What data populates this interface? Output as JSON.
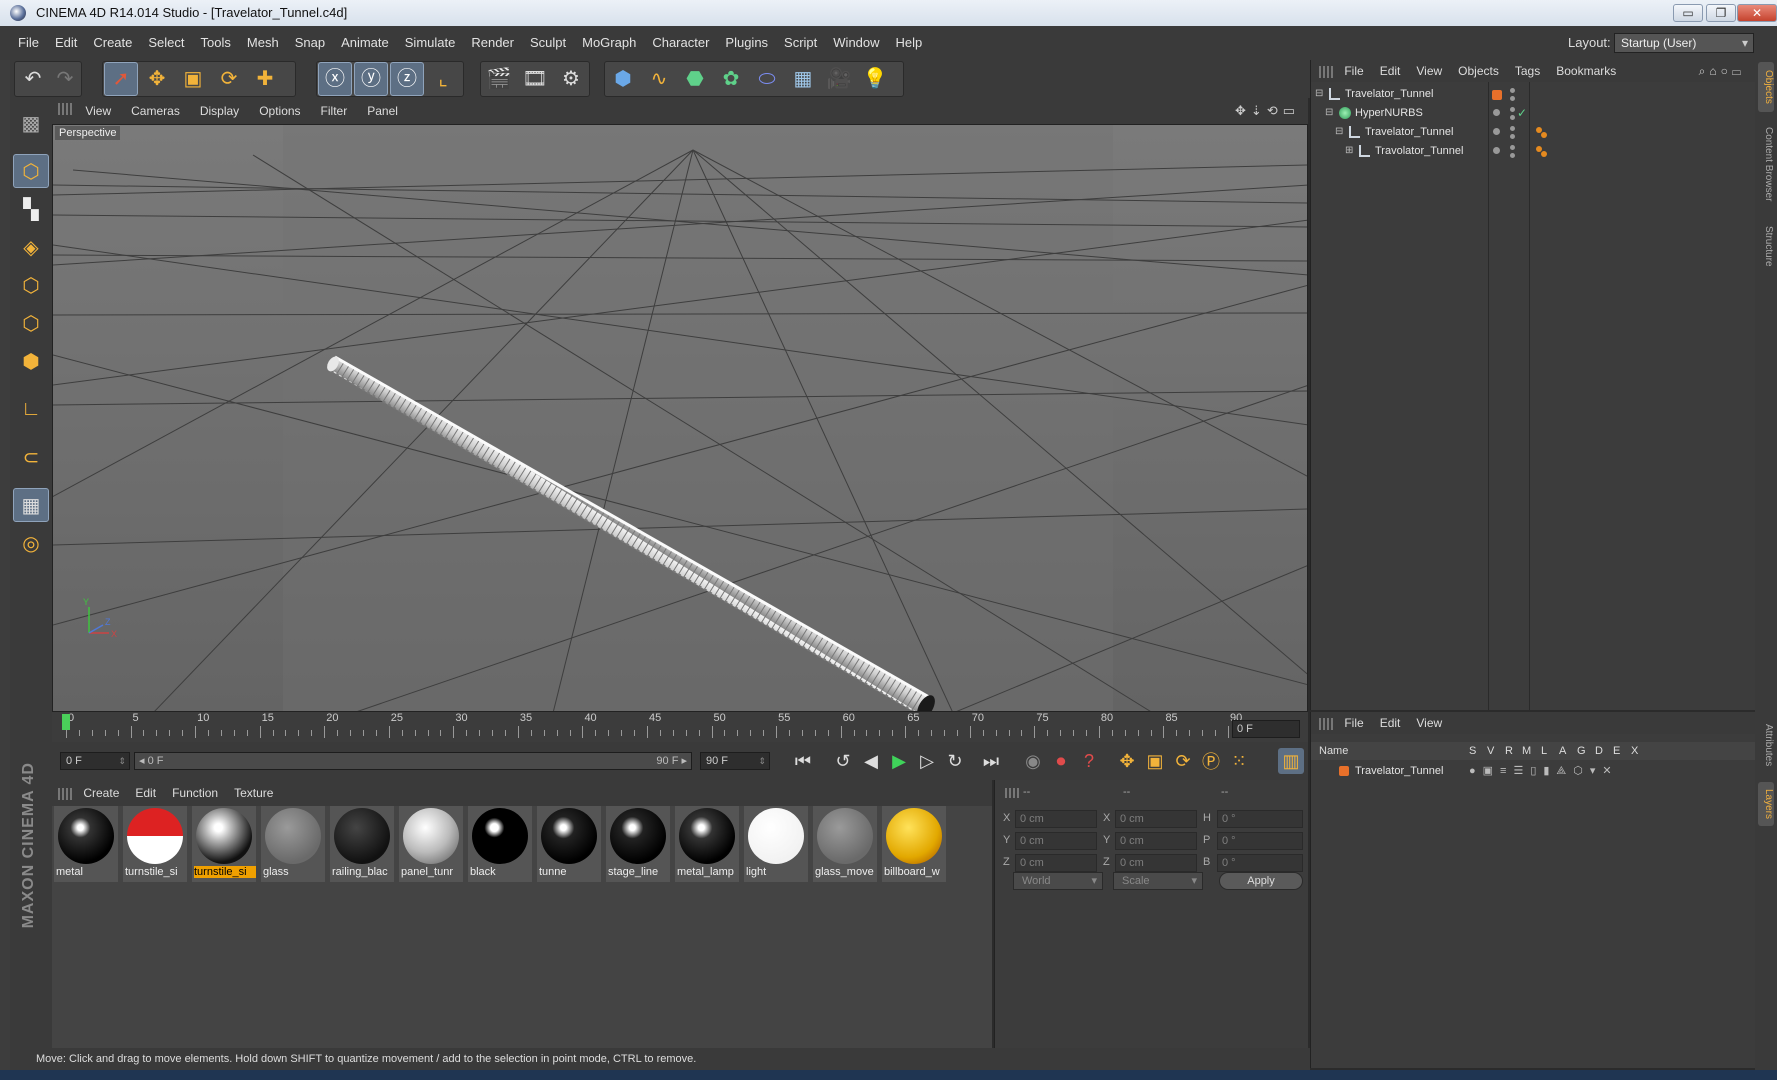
{
  "window": {
    "title": "CINEMA 4D R14.014 Studio - [Travelator_Tunnel.c4d]",
    "minimize_glyph": "▭",
    "restore_glyph": "❐",
    "close_glyph": "✕"
  },
  "menu": [
    "File",
    "Edit",
    "Create",
    "Select",
    "Tools",
    "Mesh",
    "Snap",
    "Animate",
    "Simulate",
    "Render",
    "Sculpt",
    "MoGraph",
    "Character",
    "Plugins",
    "Script",
    "Window",
    "Help"
  ],
  "layout": {
    "label": "Layout:",
    "value": "Startup (User)"
  },
  "viewport": {
    "menu": [
      "View",
      "Cameras",
      "Display",
      "Options",
      "Filter",
      "Panel"
    ],
    "label": "Perspective",
    "nav_icons": "✥⇣⟲▭"
  },
  "axis": {
    "y": "Y",
    "z": "Z",
    "x": "X"
  },
  "timeline": {
    "ticks": [
      "0",
      "5",
      "10",
      "15",
      "20",
      "25",
      "30",
      "35",
      "40",
      "45",
      "50",
      "55",
      "60",
      "65",
      "70",
      "75",
      "80",
      "85",
      "90"
    ],
    "current_frame": "0 F"
  },
  "transport": {
    "start": "0 F",
    "slider_start": "◂ 0 F",
    "slider_end": "90 F ▸",
    "end": "90 F"
  },
  "materials": {
    "menu": [
      "Create",
      "Edit",
      "Function",
      "Texture"
    ],
    "items": [
      {
        "name": "metal"
      },
      {
        "name": "turnstile_si"
      },
      {
        "name": "turnstile_si",
        "selected": true
      },
      {
        "name": "glass"
      },
      {
        "name": "railing_blac"
      },
      {
        "name": "panel_tunr"
      },
      {
        "name": "black"
      },
      {
        "name": "tunne"
      },
      {
        "name": "stage_line"
      },
      {
        "name": "metal_lamp"
      },
      {
        "name": "light"
      },
      {
        "name": "glass_move"
      },
      {
        "name": "billboard_w"
      }
    ]
  },
  "coordinates": {
    "headers": [
      "--",
      "--",
      "--"
    ],
    "rows": [
      {
        "a": "X",
        "av": "0 cm",
        "b": "X",
        "bv": "0 cm",
        "c": "H",
        "cv": "0 °"
      },
      {
        "a": "Y",
        "av": "0 cm",
        "b": "Y",
        "bv": "0 cm",
        "c": "P",
        "cv": "0 °"
      },
      {
        "a": "Z",
        "av": "0 cm",
        "b": "Z",
        "bv": "0 cm",
        "c": "B",
        "cv": "0 °"
      }
    ],
    "mode": "World",
    "mode2": "Scale",
    "apply": "Apply"
  },
  "objects": {
    "menu": [
      "File",
      "Edit",
      "View",
      "Objects",
      "Tags",
      "Bookmarks"
    ],
    "tree": [
      {
        "name": "Travelator_Tunnel",
        "level": 0
      },
      {
        "name": "HyperNURBS",
        "level": 1
      },
      {
        "name": "Travelator_Tunnel",
        "level": 2
      },
      {
        "name": "Travolator_Tunnel",
        "level": 3
      }
    ],
    "checkmark": "✓"
  },
  "layers": {
    "menu": [
      "File",
      "Edit",
      "View"
    ],
    "columns": [
      "Name",
      "S",
      "V",
      "R",
      "M",
      "L",
      "A",
      "G",
      "D",
      "E",
      "X"
    ],
    "rows": [
      {
        "name": "Travelator_Tunnel"
      }
    ]
  },
  "side_tabs": [
    "Objects",
    "Content Browser",
    "Structure",
    "Attributes",
    "Layers"
  ],
  "brand": "MAXON CINEMA 4D",
  "status": "Move: Click and drag to move elements. Hold down SHIFT to quantize movement / add to the selection in point mode, CTRL to remove.",
  "colors": {
    "accent": "#f0a000",
    "tag": "#e58a1f",
    "selected_tool": "#5d6f84"
  }
}
